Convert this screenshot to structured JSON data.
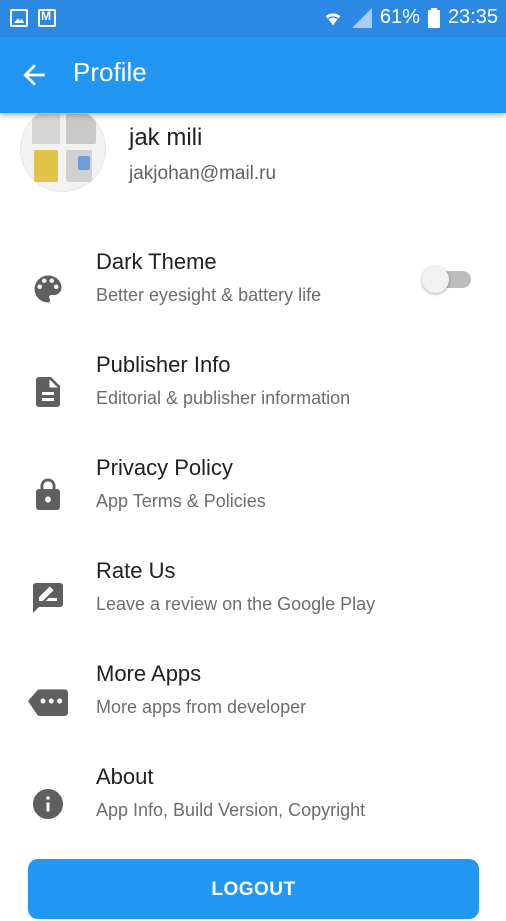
{
  "status_bar": {
    "battery_percent": "61%",
    "time": "23:35",
    "icons": [
      "gallery-icon",
      "mail-icon",
      "wifi-icon",
      "signal-icon",
      "battery-icon"
    ]
  },
  "app_bar": {
    "title": "Profile",
    "back_icon": "arrow-back-icon",
    "color": "#2196f3"
  },
  "profile": {
    "name": "jak mili",
    "email": "jakjohan@mail.ru"
  },
  "menu": {
    "dark_theme": {
      "title": "Dark Theme",
      "subtitle": "Better eyesight & battery life",
      "icon": "palette-icon",
      "toggle_on": false
    },
    "publisher": {
      "title": "Publisher Info",
      "subtitle": "Editorial & publisher information",
      "icon": "document-icon"
    },
    "privacy": {
      "title": "Privacy Policy",
      "subtitle": "App Terms & Policies",
      "icon": "lock-icon"
    },
    "rate": {
      "title": "Rate Us",
      "subtitle": "Leave a review on the Google Play",
      "icon": "rate-review-icon"
    },
    "more_apps": {
      "title": "More Apps",
      "subtitle": "More apps from developer",
      "icon": "more-apps-icon"
    },
    "about": {
      "title": "About",
      "subtitle": "App Info, Build Version, Copyright",
      "icon": "info-icon"
    }
  },
  "logout": {
    "label": "LOGOUT"
  }
}
